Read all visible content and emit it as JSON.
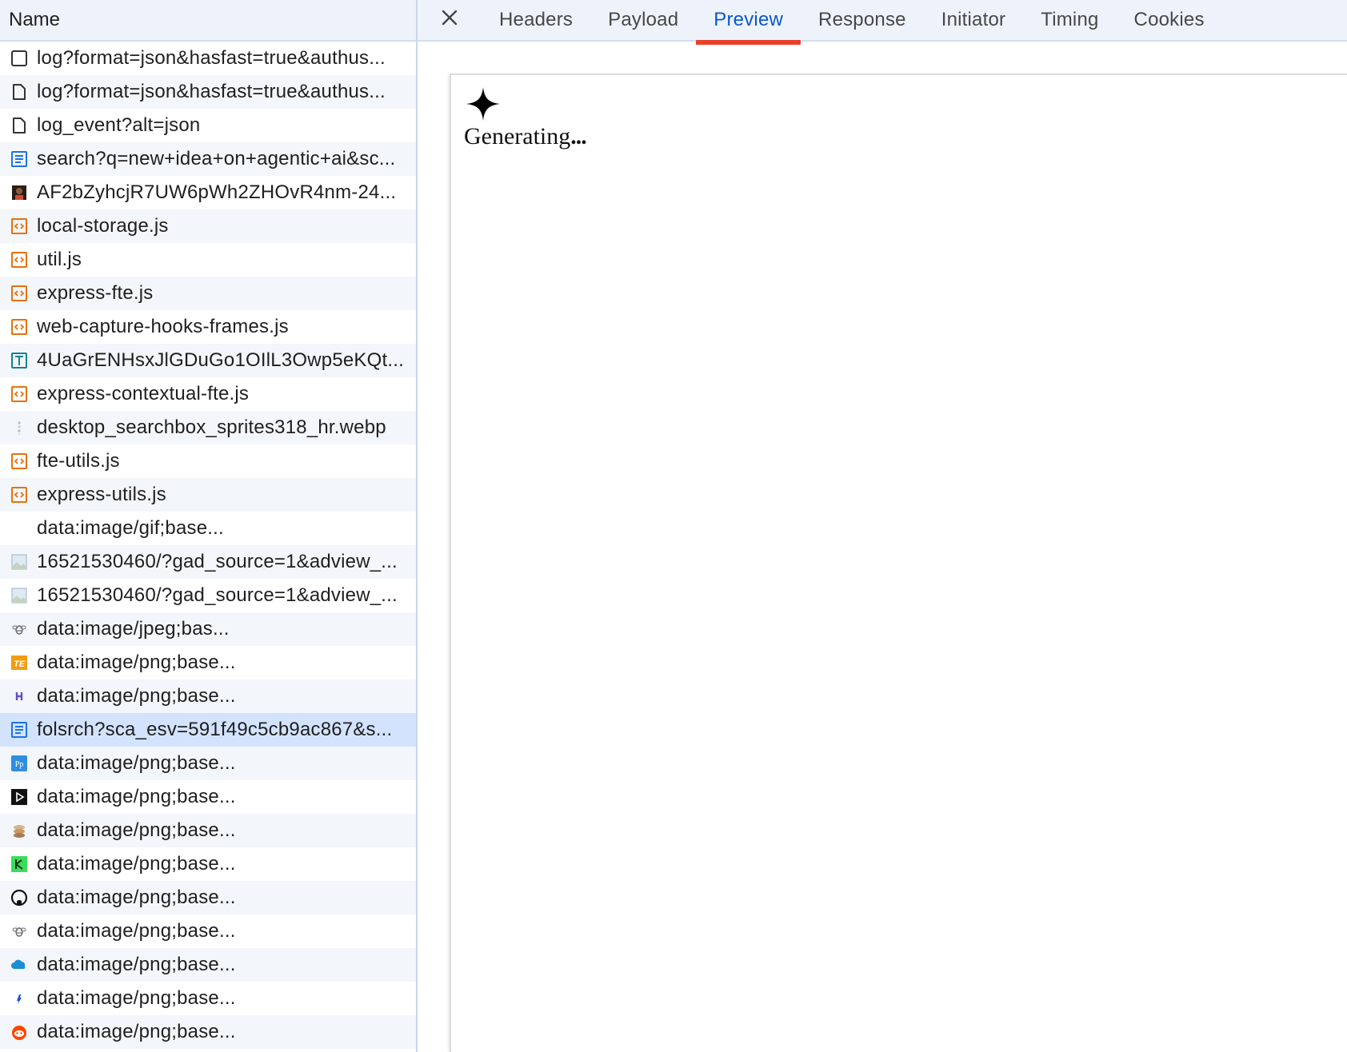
{
  "request_list": {
    "header": "Name",
    "rows": [
      {
        "name": "log?format=json&hasfast=true&authus...",
        "icon": "checkbox-icon",
        "selected": false
      },
      {
        "name": "log?format=json&hasfast=true&authus...",
        "icon": "document-icon",
        "selected": false
      },
      {
        "name": "log_event?alt=json",
        "icon": "document-icon",
        "selected": false
      },
      {
        "name": "search?q=new+idea+on+agentic+ai&sc...",
        "icon": "html-document-icon",
        "selected": false
      },
      {
        "name": "AF2bZyhcjR7UW6pWh2ZHOvR4nm-24...",
        "icon": "avatar-image-icon",
        "selected": false
      },
      {
        "name": "local-storage.js",
        "icon": "script-icon",
        "selected": false
      },
      {
        "name": "util.js",
        "icon": "script-icon",
        "selected": false
      },
      {
        "name": "express-fte.js",
        "icon": "script-icon",
        "selected": false
      },
      {
        "name": "web-capture-hooks-frames.js",
        "icon": "script-icon",
        "selected": false
      },
      {
        "name": "4UaGrENHsxJlGDuGo1OIlL3Owp5eKQt...",
        "icon": "font-icon",
        "selected": false
      },
      {
        "name": "express-contextual-fte.js",
        "icon": "script-icon",
        "selected": false
      },
      {
        "name": "desktop_searchbox_sprites318_hr.webp",
        "icon": "sprite-image-icon",
        "selected": false
      },
      {
        "name": "fte-utils.js",
        "icon": "script-icon",
        "selected": false
      },
      {
        "name": "express-utils.js",
        "icon": "script-icon",
        "selected": false
      },
      {
        "name": "data:image/gif;base...",
        "icon": "blank-icon",
        "selected": false
      },
      {
        "name": "16521530460/?gad_source=1&adview_...",
        "icon": "landscape-image-icon",
        "selected": false
      },
      {
        "name": "16521530460/?gad_source=1&adview_...",
        "icon": "landscape-image-icon",
        "selected": false
      },
      {
        "name": "data:image/jpeg;bas...",
        "icon": "bee-icon",
        "selected": false
      },
      {
        "name": "data:image/png;base...",
        "icon": "te-logo-icon",
        "selected": false
      },
      {
        "name": "data:image/png;base...",
        "icon": "small-logo-icon",
        "selected": false
      },
      {
        "name": "folsrch?sca_esv=591f49c5cb9ac867&s...",
        "icon": "html-document-icon",
        "selected": true
      },
      {
        "name": "data:image/png;base...",
        "icon": "pp-logo-icon",
        "selected": false
      },
      {
        "name": "data:image/png;base...",
        "icon": "play-logo-icon",
        "selected": false
      },
      {
        "name": "data:image/png;base...",
        "icon": "stack-logo-icon",
        "selected": false
      },
      {
        "name": "data:image/png;base...",
        "icon": "green-logo-icon",
        "selected": false
      },
      {
        "name": "data:image/png;base...",
        "icon": "github-icon",
        "selected": false
      },
      {
        "name": "data:image/png;base...",
        "icon": "bee-icon",
        "selected": false
      },
      {
        "name": "data:image/png;base...",
        "icon": "cloud-logo-icon",
        "selected": false
      },
      {
        "name": "data:image/png;base...",
        "icon": "small-blue-logo-icon",
        "selected": false
      },
      {
        "name": "data:image/png;base...",
        "icon": "reddit-icon",
        "selected": false
      }
    ]
  },
  "detail": {
    "close_icon": "close-icon",
    "tabs": [
      {
        "label": "Headers",
        "active": false
      },
      {
        "label": "Payload",
        "active": false
      },
      {
        "label": "Preview",
        "active": true
      },
      {
        "label": "Response",
        "active": false
      },
      {
        "label": "Initiator",
        "active": false
      },
      {
        "label": "Timing",
        "active": false
      },
      {
        "label": "Cookies",
        "active": false
      }
    ],
    "preview": {
      "sparkle_icon": "sparkle-icon",
      "text": "Generating",
      "dots": "..."
    }
  },
  "colors": {
    "header_bg": "#eef3fb",
    "active_tab_text": "#0b57d0",
    "active_tab_underline": "#e8412b",
    "selected_row_bg": "#d3e3fd",
    "script_icon": "#e8710a",
    "document_icon_blue": "#1a73e8"
  }
}
